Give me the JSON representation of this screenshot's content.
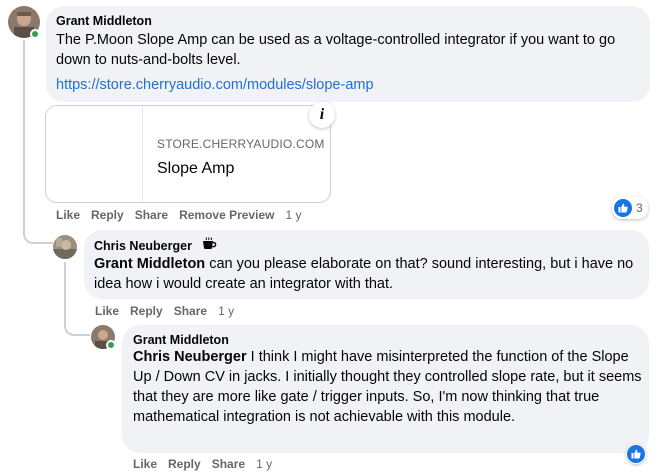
{
  "comments": [
    {
      "author": "Grant Middleton",
      "text": "The P.Moon Slope Amp can be used as a voltage-controlled integrator if you want to go down to nuts-and-bolts level.",
      "link": "https://store.cherryaudio.com/modules/slope-amp",
      "preview": {
        "domain": "STORE.CHERRYAUDIO.COM",
        "title": "Slope Amp",
        "info_glyph": "i"
      },
      "actions": {
        "like": "Like",
        "reply": "Reply",
        "share": "Share",
        "remove_preview": "Remove Preview",
        "time": "1 y"
      },
      "reaction_count": "3"
    },
    {
      "author": "Chris Neuberger",
      "badge_icon": "coffee-cup-icon",
      "mention": "Grant Middleton",
      "text": " can you please elaborate on that? sound interesting, but i have no idea how i would create an integrator with that.",
      "actions": {
        "like": "Like",
        "reply": "Reply",
        "share": "Share",
        "time": "1 y"
      }
    },
    {
      "author": "Grant Middleton",
      "mention": "Chris Neuberger",
      "text": " I think I might have misinterpreted the function of the Slope Up / Down CV in jacks. I initially thought they controlled slope rate, but it seems that they are more like gate / trigger inputs. So, I'm now thinking that true mathematical integration is not achievable with this module.",
      "actions": {
        "like": "Like",
        "reply": "Reply",
        "share": "Share",
        "time": "1 y"
      }
    }
  ],
  "colors": {
    "bubble": "#f0f2f5",
    "link": "#216fdb",
    "like_blue": "#1b74e4",
    "online": "#31a24c",
    "meta": "#65676b"
  }
}
